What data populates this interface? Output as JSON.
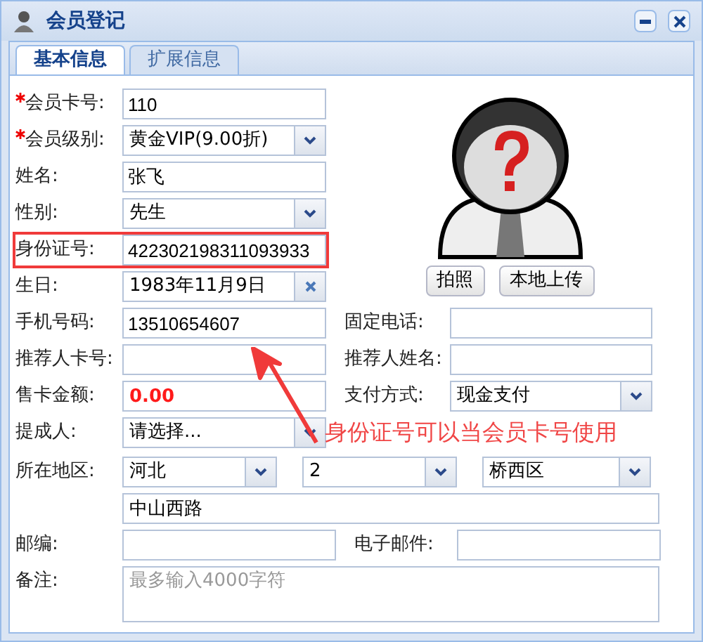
{
  "window": {
    "title": "会员登记"
  },
  "tabs": [
    {
      "label": "基本信息",
      "selected": true
    },
    {
      "label": "扩展信息",
      "selected": false
    }
  ],
  "basic_fields": [
    {
      "label": "会员卡号:",
      "required": true,
      "kind": "text",
      "value": "110",
      "highlighted": false
    },
    {
      "label": "会员级别:",
      "required": true,
      "kind": "select",
      "value": "黄金VIP(9.00折)",
      "highlighted": false
    },
    {
      "label": "姓名:",
      "required": false,
      "kind": "text",
      "value": "张飞",
      "highlighted": false
    },
    {
      "label": "性别:",
      "required": false,
      "kind": "select",
      "value": "先生",
      "highlighted": false
    },
    {
      "label": "身份证号:",
      "required": false,
      "kind": "text",
      "value": "422302198311093933",
      "highlighted": true
    },
    {
      "label": "生日:",
      "required": false,
      "kind": "date",
      "value": "1983年11月9日",
      "highlighted": false
    }
  ],
  "photo_buttons": [
    "拍照",
    "本地上传"
  ],
  "pair_rows": [
    {
      "left": {
        "label": "手机号码:",
        "kind": "text",
        "value": "13510654607"
      },
      "right": {
        "label": "固定电话:",
        "kind": "text"
      }
    },
    {
      "left": {
        "label": "推荐人卡号:",
        "kind": "text"
      },
      "right": {
        "label": "推荐人姓名:",
        "kind": "text"
      }
    },
    {
      "left": {
        "label": "售卡金额:",
        "kind": "amount",
        "value": "0.00"
      },
      "right": {
        "label": "支付方式:",
        "kind": "select",
        "value": "现金支付"
      }
    },
    {
      "left": {
        "label": "提成人:",
        "kind": "select",
        "value": "请选择..."
      }
    }
  ],
  "region": {
    "label": "所在地区:",
    "selects": [
      "河北",
      "2",
      "桥西区"
    ],
    "address": "中山西路"
  },
  "postal": {
    "label": "邮编:"
  },
  "email": {
    "label": "电子邮件:"
  },
  "memo": {
    "label": "备注:",
    "placeholder": "最多输入4000字符"
  },
  "annotation": {
    "text": "身份证号可以当会员卡号使用"
  }
}
